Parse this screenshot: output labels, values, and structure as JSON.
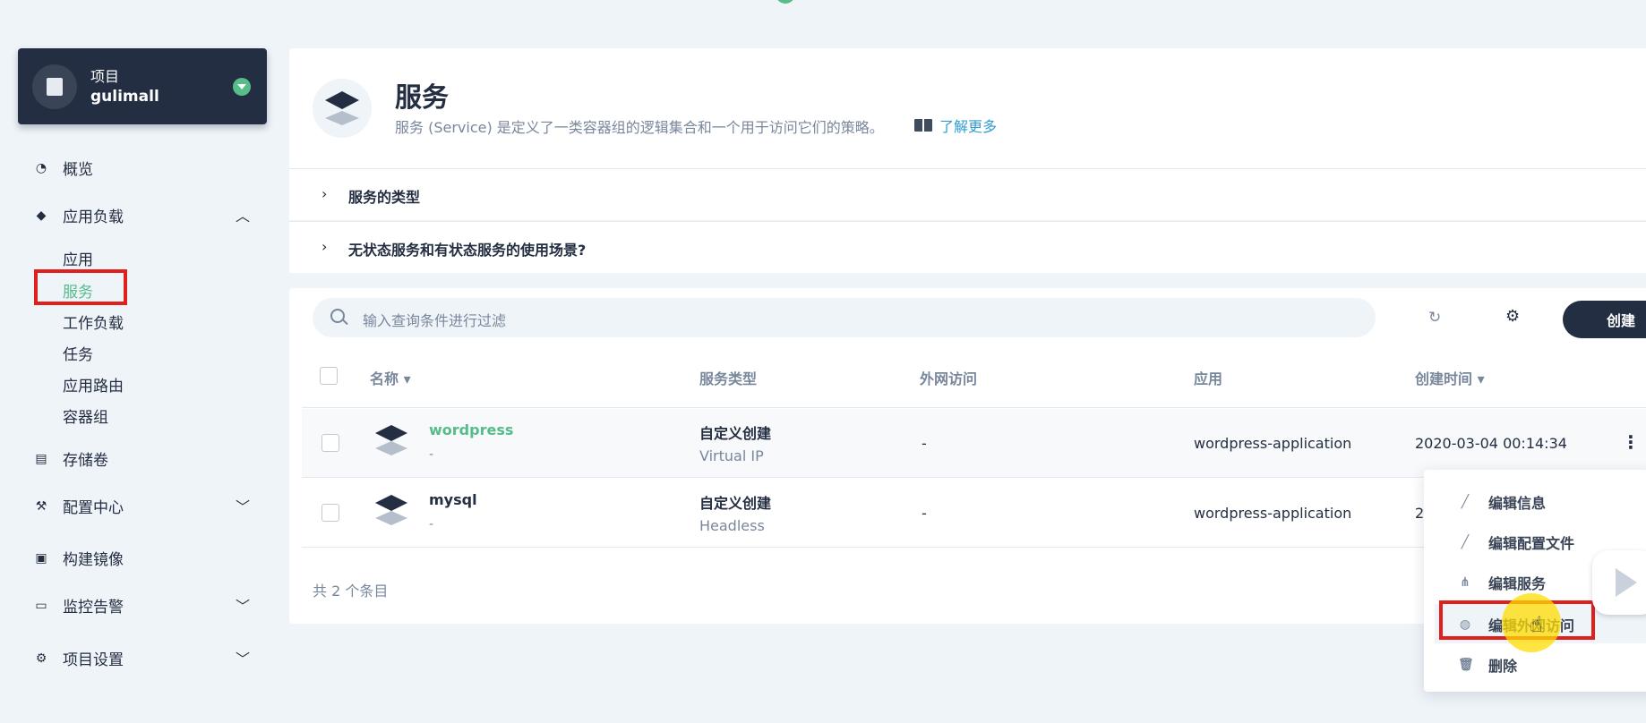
{
  "project": {
    "label": "项目",
    "name": "gulimall"
  },
  "nav": {
    "overview": "概览",
    "workloads": "应用负载",
    "sub": [
      "应用",
      "服务",
      "工作负载",
      "任务",
      "应用路由",
      "容器组"
    ],
    "storage": "存储卷",
    "config": "配置中心",
    "images": "构建镜像",
    "monitoring": "监控告警",
    "settings": "项目设置"
  },
  "header": {
    "title": "服务",
    "description": "服务 (Service) 是定义了一类容器组的逻辑集合和一个用于访问它们的策略。",
    "learn_more": "了解更多"
  },
  "accordions": [
    "服务的类型",
    "无状态服务和有状态服务的使用场景?"
  ],
  "toolbar": {
    "search_placeholder": "输入查询条件进行过滤",
    "create_label": "创建"
  },
  "table": {
    "columns": {
      "name": "名称",
      "type": "服务类型",
      "external": "外网访问",
      "app": "应用",
      "created": "创建时间"
    },
    "rows": [
      {
        "name": "wordpress",
        "sub": "-",
        "type": "自定义创建",
        "type_detail": "Virtual IP",
        "external": "-",
        "app": "wordpress-application",
        "created": "2020-03-04 00:14:34"
      },
      {
        "name": "mysql",
        "sub": "-",
        "type": "自定义创建",
        "type_detail": "Headless",
        "external": "-",
        "app": "wordpress-application",
        "created": "2"
      }
    ],
    "total": "共 2 个条目"
  },
  "menu": {
    "items": [
      "编辑信息",
      "编辑配置文件",
      "编辑服务",
      "编辑外网访问",
      "删除"
    ]
  },
  "colors": {
    "accent": "#55bc8a",
    "dark": "#242e42",
    "highlight_box": "#e0201c",
    "link": "#329dce"
  }
}
